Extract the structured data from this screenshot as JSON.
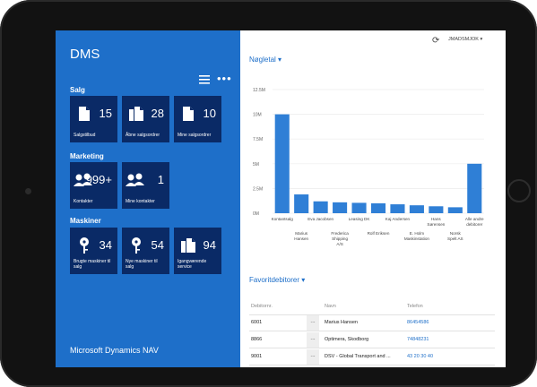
{
  "app": {
    "title": "DMS",
    "footer": "Microsoft Dynamics NAV",
    "user": "JMADSMJOK ▾"
  },
  "groups": {
    "salg": {
      "label": "Salg",
      "tiles": [
        {
          "count": "15",
          "label": "Salgstilbud",
          "icon": "document-icon"
        },
        {
          "count": "28",
          "label": "Åbne salgsordrer",
          "icon": "documents-icon"
        },
        {
          "count": "10",
          "label": "Mine salgsordrer",
          "icon": "document-icon"
        }
      ]
    },
    "marketing": {
      "label": "Marketing",
      "tiles": [
        {
          "count": "999+",
          "label": "Kontakter",
          "icon": "people-icon"
        },
        {
          "count": "1",
          "label": "Mine kontakter",
          "icon": "people-icon"
        }
      ]
    },
    "maskiner": {
      "label": "Maskiner",
      "tiles": [
        {
          "count": "34",
          "label": "Brugte maskiner til salg",
          "icon": "key-icon"
        },
        {
          "count": "54",
          "label": "Nye maskiner til salg",
          "icon": "key-icon"
        },
        {
          "count": "94",
          "label": "Igangværende service",
          "icon": "documents-icon"
        }
      ]
    }
  },
  "keyfigures": {
    "title": "Nøgletal ▾"
  },
  "chart_data": {
    "type": "bar",
    "categories": [
      "Kontantsalg",
      "Marius Hansen",
      "Eva Jacobsen",
      "Frederica Shipping A/S",
      "Leasing DK",
      "Rolf Eriksen",
      "Kaj Andersen",
      "E. Holm Maskinstation",
      "Hans Sørensen",
      "Norsk Spelt AS",
      "Alle andre debitorer"
    ],
    "values": [
      10.0,
      1.9,
      1.2,
      1.1,
      1.05,
      1.0,
      0.9,
      0.8,
      0.7,
      0.6,
      5.0
    ],
    "ticks": [
      "12.5M",
      "10M",
      "7.5M",
      "5M",
      "2.5M",
      "0M"
    ],
    "ylim": [
      0,
      12.5
    ],
    "color": "#2f7fd6",
    "grid": true
  },
  "favorites": {
    "title": "Favoritdebitorer ▾",
    "headers": [
      "Debitornr.",
      "Navn",
      "Telefon"
    ],
    "rows": [
      {
        "no": "6001",
        "name": "Marius Hansen",
        "phone": "86454586"
      },
      {
        "no": "8866",
        "name": "Optimera, Skodborg",
        "phone": "74848231"
      },
      {
        "no": "9001",
        "name": "DSV - Global Transport and ...",
        "phone": "43 20 30 40"
      }
    ]
  }
}
